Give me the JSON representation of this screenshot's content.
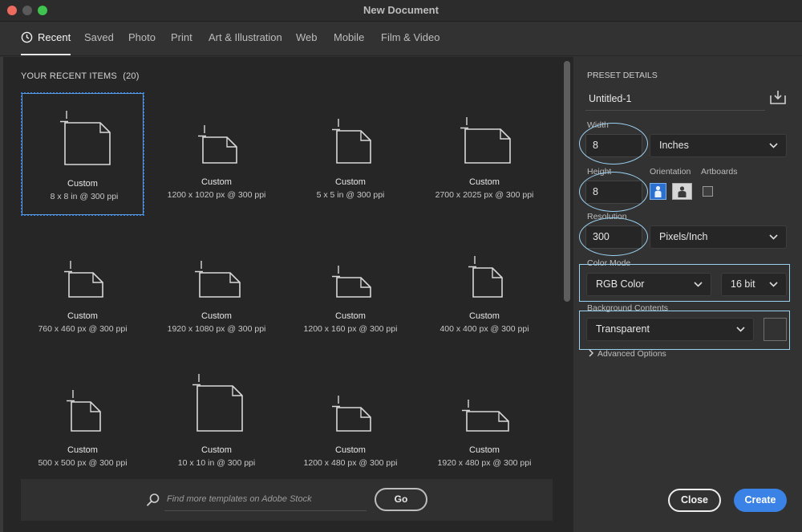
{
  "window": {
    "title": "New Document"
  },
  "tabs": [
    {
      "label": "Recent",
      "active": true
    },
    {
      "label": "Saved"
    },
    {
      "label": "Photo"
    },
    {
      "label": "Print"
    },
    {
      "label": "Art & Illustration"
    },
    {
      "label": "Web"
    },
    {
      "label": "Mobile"
    },
    {
      "label": "Film & Video"
    }
  ],
  "recent": {
    "header": "YOUR RECENT ITEMS",
    "count": "(20)",
    "items": [
      {
        "name": "Custom",
        "size": "8 x 8 in @ 300 ppi",
        "selected": true
      },
      {
        "name": "Custom",
        "size": "1200 x 1020 px @ 300 ppi"
      },
      {
        "name": "Custom",
        "size": "5 x 5 in @ 300 ppi"
      },
      {
        "name": "Custom",
        "size": "2700 x 2025 px @ 300 ppi"
      },
      {
        "name": "Custom",
        "size": "760 x 460 px @ 300 ppi"
      },
      {
        "name": "Custom",
        "size": "1920 x 1080 px @ 300 ppi"
      },
      {
        "name": "Custom",
        "size": "1200 x 160 px @ 300 ppi"
      },
      {
        "name": "Custom",
        "size": "400 x 400 px @ 300 ppi"
      },
      {
        "name": "Custom",
        "size": "500 x 500 px @ 300 ppi"
      },
      {
        "name": "Custom",
        "size": "10 x 10 in @ 300 ppi"
      },
      {
        "name": "Custom",
        "size": "1200 x 480 px @ 300 ppi"
      },
      {
        "name": "Custom",
        "size": "1920 x 480 px @ 300 ppi"
      }
    ]
  },
  "search": {
    "placeholder": "Find more templates on Adobe Stock",
    "go_label": "Go"
  },
  "preset": {
    "section_title": "PRESET DETAILS",
    "name": "Untitled-1",
    "width_label": "Width",
    "width_value": "8",
    "width_unit": "Inches",
    "height_label": "Height",
    "height_value": "8",
    "orientation_label": "Orientation",
    "artboards_label": "Artboards",
    "resolution_label": "Resolution",
    "resolution_value": "300",
    "resolution_unit": "Pixels/Inch",
    "color_mode_label": "Color Mode",
    "color_mode": "RGB Color",
    "bit_depth": "16 bit",
    "background_label": "Background Contents",
    "background": "Transparent",
    "advanced_label": "Advanced Options"
  },
  "actions": {
    "close_label": "Close",
    "create_label": "Create"
  },
  "colors": {
    "accent": "#3a82e6",
    "annotation": "#9bd1f0"
  }
}
